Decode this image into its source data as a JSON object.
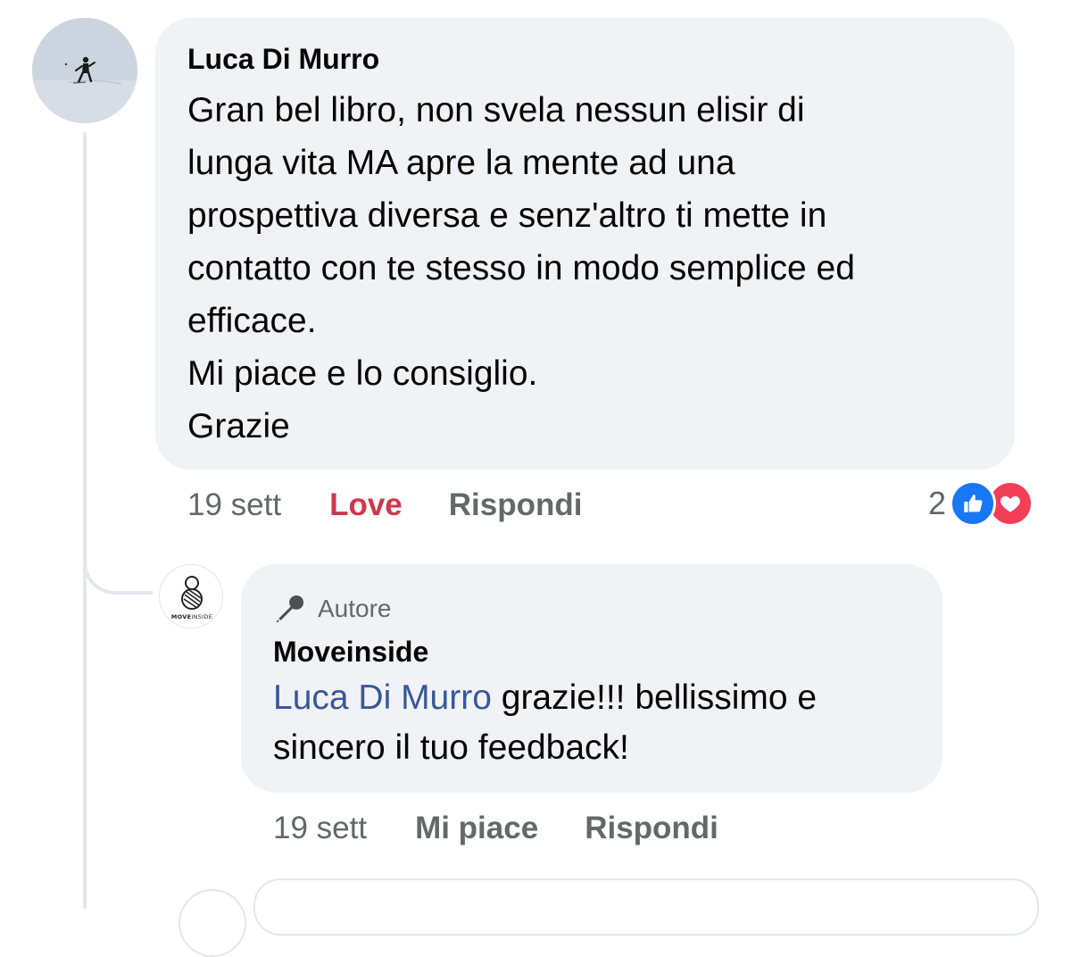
{
  "comment": {
    "author": "Luca Di Murro",
    "text_lines": [
      "Gran bel libro, non svela nessun elisir di",
      "lunga vita MA apre la mente ad una",
      "prospettiva diversa e senz'altro ti mette in",
      "contatto con te stesso in modo semplice ed",
      "efficace.",
      "Mi piace e lo consiglio.",
      "Grazie"
    ],
    "actions": {
      "time": "19 sett",
      "love_label": "Love",
      "reply_label": "Rispondi"
    },
    "reactions": {
      "count": "2",
      "types": [
        "like-icon",
        "love-icon"
      ]
    }
  },
  "reply": {
    "badge": "Autore",
    "author": "Moveinside",
    "avatar_logo_text": "MOVEINSIDE",
    "mention": "Luca Di Murro",
    "text_line_1": " grazie!!! bellissimo e",
    "text_line_2": "sincero il tuo feedback!",
    "actions": {
      "time": "19 sett",
      "like_label": "Mi piace",
      "reply_label": "Rispondi"
    }
  },
  "colors": {
    "bubble": "#f0f2f5",
    "secondary_text": "#65676b",
    "love_red": "#d0374b",
    "like_blue": "#1877f2",
    "heart_pink": "#f33e58",
    "mention_blue": "#385898"
  }
}
